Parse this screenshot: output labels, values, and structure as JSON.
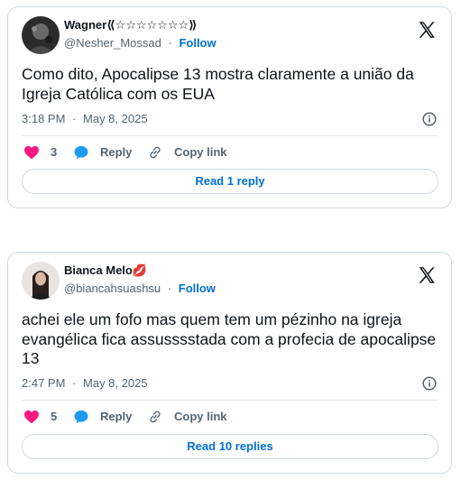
{
  "tweets": [
    {
      "author_name": "Wagner⟪☆☆☆☆☆☆☆⟫",
      "handle": "@Nesher_Mossad",
      "separator": "·",
      "follow_label": "Follow",
      "text": "Como dito, Apocalipse 13 mostra claramente a união da Igreja Católica com os EUA",
      "time": "3:18 PM",
      "date": "May 8, 2025",
      "meta_separator": "·",
      "like_count": "3",
      "reply_label": "Reply",
      "copy_label": "Copy link",
      "read_label": "Read 1 reply"
    },
    {
      "author_name": "Bianca Melo💋",
      "handle": "@biancahsuashsu",
      "separator": "·",
      "follow_label": "Follow",
      "text": "achei ele um fofo mas quem tem um pézinho na igreja evangélica fica assusssstada com a profecia de apocalipse 13",
      "time": "2:47 PM",
      "date": "May 8, 2025",
      "meta_separator": "·",
      "like_count": "5",
      "reply_label": "Reply",
      "copy_label": "Copy link",
      "read_label": "Read 10 replies"
    }
  ],
  "colors": {
    "accent": "#006fd6",
    "like": "#f91880",
    "reply": "#1d9bf0",
    "muted": "#536471",
    "border": "#cfd9de"
  },
  "icons": {
    "brand": "x-logo-icon",
    "info": "info-icon",
    "like": "heart-icon",
    "reply": "speech-bubble-icon",
    "copy": "link-icon"
  }
}
